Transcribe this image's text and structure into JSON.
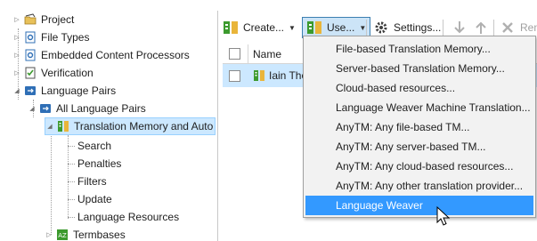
{
  "tree": {
    "items": [
      {
        "label": "Project",
        "icon": "project-folder-icon"
      },
      {
        "label": "File Types",
        "icon": "file-types-icon"
      },
      {
        "label": "Embedded Content Processors",
        "icon": "embedded-processor-icon"
      },
      {
        "label": "Verification",
        "icon": "verification-icon"
      },
      {
        "label": "Language Pairs",
        "icon": "language-pairs-icon"
      },
      {
        "label": "All Language Pairs",
        "icon": "language-pairs-icon"
      },
      {
        "label": "Translation Memory and Auto",
        "icon": "translation-memory-icon"
      },
      {
        "label": "Search"
      },
      {
        "label": "Penalties"
      },
      {
        "label": "Filters"
      },
      {
        "label": "Update"
      },
      {
        "label": "Language Resources"
      },
      {
        "label": "Termbases",
        "icon": "termbase-icon"
      }
    ]
  },
  "toolbar": {
    "create_label": "Create...",
    "use_label": "Use...",
    "settings_label": "Settings...",
    "remove_label": "Rem"
  },
  "grid": {
    "column_name": "Name",
    "row_text": "Iain Thor"
  },
  "menu": {
    "items": [
      "File-based Translation Memory...",
      "Server-based Translation Memory...",
      "Cloud-based resources...",
      "Language Weaver Machine Translation...",
      "AnyTM: Any file-based TM...",
      "AnyTM: Any server-based TM...",
      "AnyTM: Any cloud-based resources...",
      "AnyTM: Any other translation provider...",
      "Language Weaver"
    ],
    "highlighted": "Language Weaver"
  },
  "colors": {
    "selection": "#cce8ff",
    "menu_highlight": "#3399ff",
    "tm_green": "#3c9a2e",
    "tree_blue": "#2f6fb6"
  }
}
